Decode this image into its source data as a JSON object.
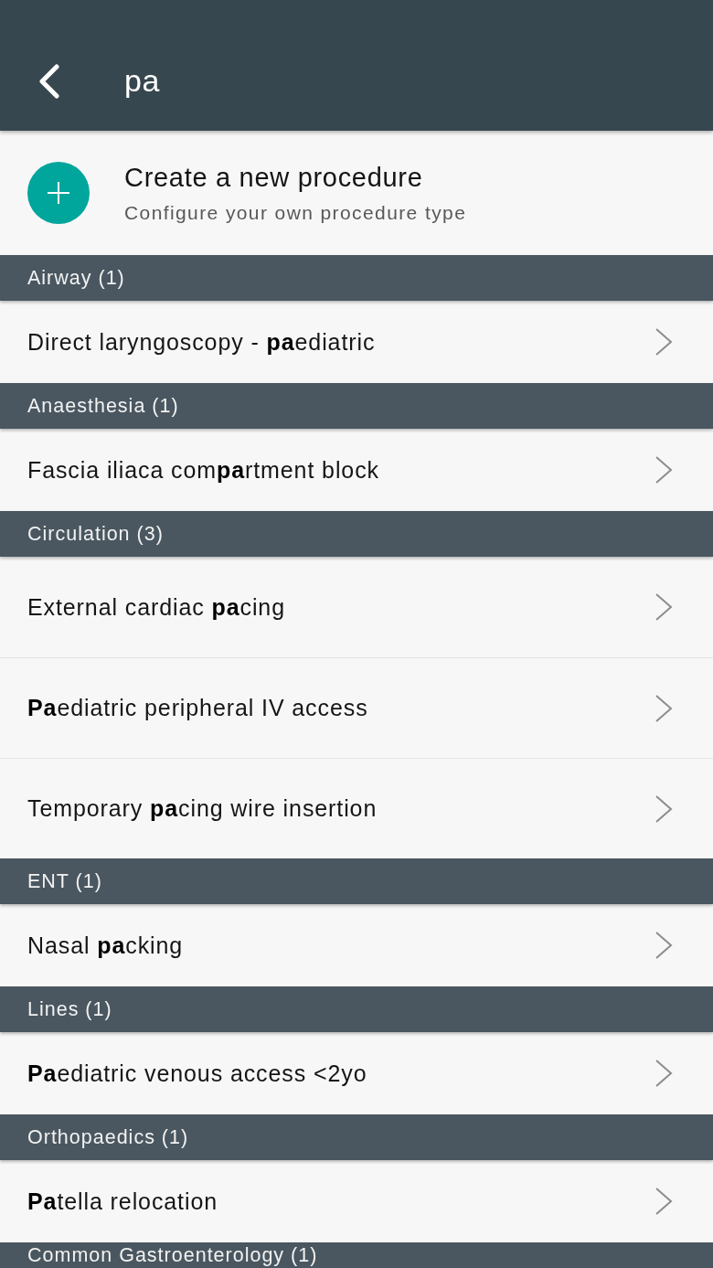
{
  "app_bar": {
    "search": {
      "value": "pa"
    }
  },
  "create_item": {
    "title": "Create a new procedure",
    "subtitle": "Configure your own procedure type"
  },
  "sections": [
    {
      "title": "Airway (1)",
      "items": [
        "Direct laryngoscopy - **pa**ediatric"
      ]
    },
    {
      "title": "Anaesthesia (1)",
      "items": [
        "Fascia iliaca com**pa**rtment block"
      ]
    },
    {
      "title": "Circulation (3)",
      "items": [
        "External cardiac **pa**cing",
        "**Pa**ediatric peripheral IV access",
        "Temporary **pa**cing wire insertion"
      ]
    },
    {
      "title": "ENT (1)",
      "items": [
        "Nasal **pa**cking"
      ]
    },
    {
      "title": "Lines (1)",
      "items": [
        "**Pa**ediatric venous access <2yo"
      ]
    },
    {
      "title": "Orthopaedics (1)",
      "items": [
        "**Pa**tella relocation"
      ]
    },
    {
      "title": "Common Gastroenterology (1)"
    }
  ]
}
